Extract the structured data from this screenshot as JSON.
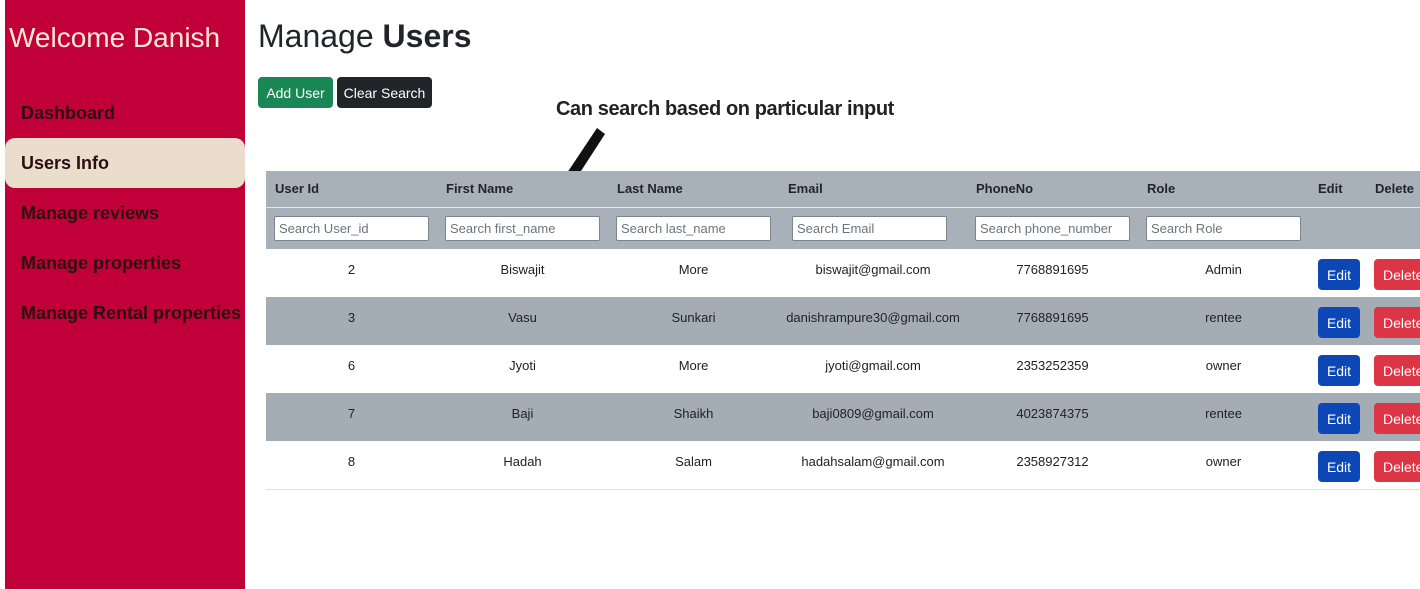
{
  "sidebar": {
    "title": "Welcome Danish",
    "items": [
      {
        "label": "Dashboard",
        "active": false
      },
      {
        "label": "Users Info",
        "active": true
      },
      {
        "label": "Manage reviews",
        "active": false
      },
      {
        "label": "Manage properties",
        "active": false
      },
      {
        "label": "Manage Rental properties",
        "active": false
      }
    ]
  },
  "header": {
    "title_normal": "Manage",
    "title_bold": "Users"
  },
  "toolbar": {
    "add_label": "Add User",
    "clear_label": "Clear Search"
  },
  "annotation": {
    "text": "Can search based on particular input"
  },
  "table": {
    "columns": [
      "User Id",
      "First Name",
      "Last Name",
      "Email",
      "PhoneNo",
      "Role",
      "Edit",
      "Delete"
    ],
    "filters": {
      "user_id": "Search User_id",
      "first_name": "Search first_name",
      "last_name": "Search last_name",
      "email": "Search Email",
      "phone": "Search phone_number",
      "role": "Search Role"
    },
    "rows": [
      {
        "id": "2",
        "first": "Biswajit",
        "last": "More",
        "email": "biswajit@gmail.com",
        "phone": "7768891695",
        "role": "Admin"
      },
      {
        "id": "3",
        "first": "Vasu",
        "last": "Sunkari",
        "email": "danishrampure30@gmail.com",
        "phone": "7768891695",
        "role": "rentee"
      },
      {
        "id": "6",
        "first": "Jyoti",
        "last": "More",
        "email": "jyoti@gmail.com",
        "phone": "2353252359",
        "role": "owner"
      },
      {
        "id": "7",
        "first": "Baji",
        "last": "Shaikh",
        "email": "baji0809@gmail.com",
        "phone": "4023874375",
        "role": "rentee"
      },
      {
        "id": "8",
        "first": "Hadah",
        "last": "Salam",
        "email": "hadahsalam@gmail.com",
        "phone": "2358927312",
        "role": "owner"
      }
    ],
    "edit_label": "Edit",
    "delete_label": "Delete"
  },
  "colors": {
    "sidebar_bg": "#c1003a",
    "active_item_bg": "#eaddcb",
    "table_header_bg": "#a8b1ba",
    "add_button": "#198754",
    "edit_button": "#0d47b5",
    "delete_button": "#dc3545"
  }
}
